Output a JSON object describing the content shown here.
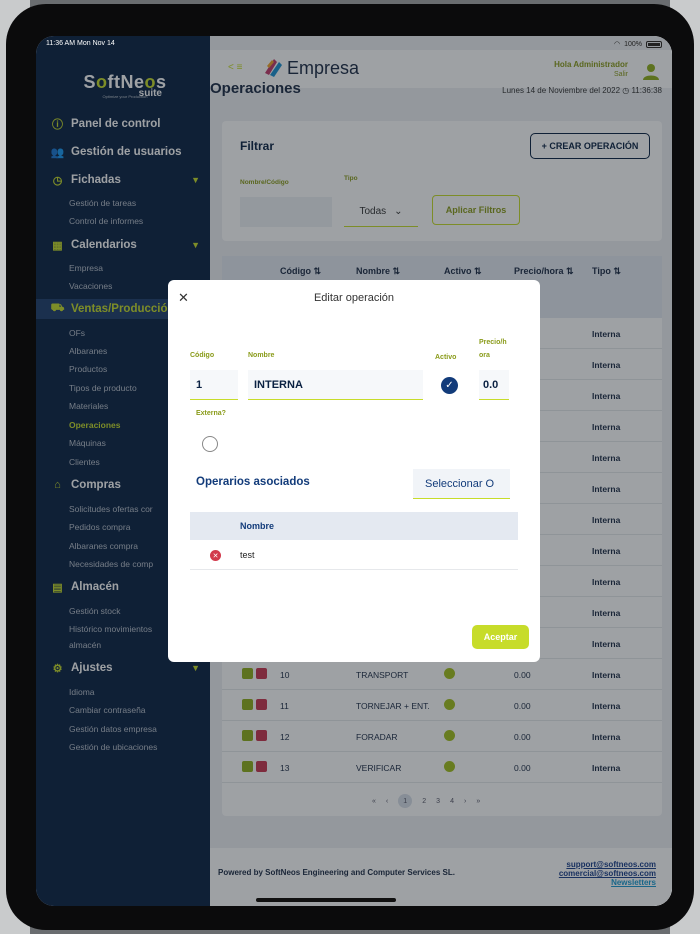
{
  "status": {
    "time": "11:36 AM  Mon Nov 14",
    "battery": "100%"
  },
  "logo": {
    "name_a": "S",
    "name_b": "ft",
    "name_c": "Ne",
    "name_d": "s",
    "suite": "suite",
    "tagline": "Optimize your Production"
  },
  "sidebar": {
    "panel": "Panel de control",
    "usuarios": "Gestión de usuarios",
    "fichadas": "Fichadas",
    "fichadas_items": [
      "Gestión de tareas",
      "Control de informes"
    ],
    "calendarios": "Calendarios",
    "calendarios_items": [
      "Empresa",
      "Vacaciones"
    ],
    "ventas": "Ventas/Producción",
    "ventas_items": [
      "OFs",
      "Albaranes",
      "Productos",
      "Tipos de producto",
      "Materiales",
      "Operaciones",
      "Máquinas",
      "Clientes"
    ],
    "compras": "Compras",
    "compras_items": [
      "Solicitudes ofertas cor",
      "Pedidos compra",
      "Albaranes compra",
      "Necesidades de comp"
    ],
    "almacen": "Almacén",
    "almacen_items": [
      "Gestión stock",
      "Histórico movimientos",
      "almacén"
    ],
    "ajustes": "Ajustes",
    "ajustes_items": [
      "Idioma",
      "Cambiar contraseña",
      "Gestión datos empresa",
      "Gestión de ubicaciones"
    ]
  },
  "topbar": {
    "back": "< ≡",
    "brand": "Empresa",
    "hello": "Hola Administrador",
    "salir": "Salir"
  },
  "page": {
    "title": "Operaciones",
    "date": "Lunes 14 de Noviembre del 2022  ◷ 11:36:38"
  },
  "filter": {
    "title": "Filtrar",
    "crear": "+ CREAR OPERACIÓN",
    "label_nombre": "Nombre/Código",
    "label_tipo": "Tipo",
    "tipo_value": "Todas",
    "apply": "Aplicar Filtros"
  },
  "table": {
    "headers": [
      "Código ⇅",
      "Nombre ⇅",
      "Activo ⇅",
      "Precio/hora ⇅",
      "Tipo ⇅"
    ],
    "rows": [
      {
        "cod": "",
        "nom": "",
        "pre": "",
        "tip": "Interna"
      },
      {
        "cod": "",
        "nom": "",
        "pre": "",
        "tip": "Interna"
      },
      {
        "cod": "",
        "nom": "",
        "pre": "",
        "tip": "Interna"
      },
      {
        "cod": "",
        "nom": "",
        "pre": "",
        "tip": "Interna"
      },
      {
        "cod": "",
        "nom": "",
        "pre": "",
        "tip": "Interna"
      },
      {
        "cod": "",
        "nom": "",
        "pre": "",
        "tip": "Interna"
      },
      {
        "cod": "",
        "nom": "",
        "pre": "",
        "tip": "Interna"
      },
      {
        "cod": "",
        "nom": "",
        "pre": "",
        "tip": "Interna"
      },
      {
        "cod": "",
        "nom": "",
        "pre": "",
        "tip": "Interna"
      },
      {
        "cod": "",
        "nom": "",
        "pre": "",
        "tip": "Interna"
      },
      {
        "cod": "",
        "nom": "",
        "pre": "",
        "tip": "Interna"
      },
      {
        "cod": "10",
        "nom": "TRANSPORT",
        "pre": "0.00",
        "tip": "Interna"
      },
      {
        "cod": "11",
        "nom": "TORNEJAR + ENT.",
        "pre": "0.00",
        "tip": "Interna"
      },
      {
        "cod": "12",
        "nom": "FORADAR",
        "pre": "0.00",
        "tip": "Interna"
      },
      {
        "cod": "13",
        "nom": "VERIFICAR",
        "pre": "0.00",
        "tip": "Interna"
      }
    ],
    "pager": [
      "«",
      "‹",
      "1",
      "2",
      "3",
      "4",
      "›",
      "»"
    ]
  },
  "footer": {
    "powered": "Powered by SoftNeos Engineering and Computer Services SL.",
    "support": "support@softneos.com",
    "comercial": "comercial@softneos.com",
    "newsletters": "Newsletters"
  },
  "modal": {
    "title": "Editar operación",
    "label_codigo": "Código",
    "codigo": "1",
    "label_nombre": "Nombre",
    "nombre": "INTERNA",
    "label_activo": "Activo",
    "label_precio": "Precio/h ora",
    "precio": "0.0",
    "label_externa": "Externa?",
    "operarios_title": "Operarios asociados",
    "select_btn": "Seleccionar O",
    "inner_header": "Nombre",
    "inner_row": "test",
    "aceptar": "Aceptar"
  },
  "colors": {
    "sidebar": "#0a2142",
    "accent": "#c7dc2a",
    "primary_text": "#123b7a"
  }
}
